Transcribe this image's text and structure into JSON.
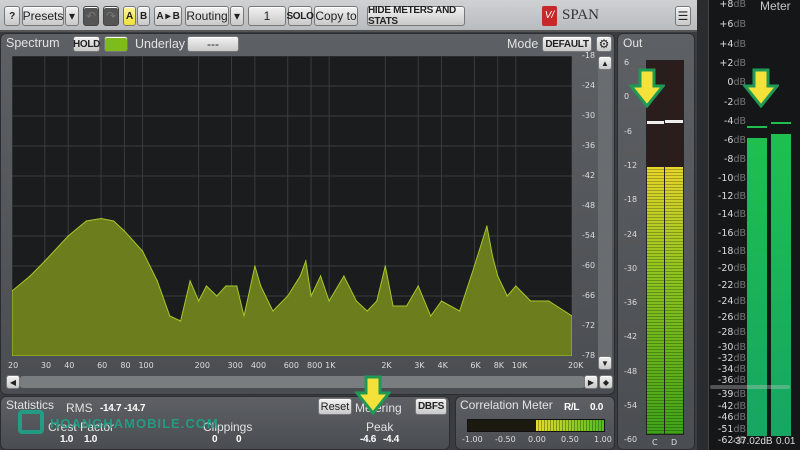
{
  "toolbar": {
    "help": "?",
    "presets": "Presets",
    "dropdown": "▾",
    "a": "A",
    "b": "B",
    "a_to_b": "A ▸ B",
    "routing": "Routing",
    "channel": "1",
    "solo": "SOLO",
    "copy_to": "Copy to",
    "hide_meters": "HIDE METERS AND STATS",
    "app_name": "SPAN",
    "menu": "☰"
  },
  "spectrum": {
    "tab": "Spectrum",
    "hold": "HOLD",
    "underlay_label": "Underlay",
    "underlay_value": "---",
    "mode_label": "Mode",
    "mode_value": "DEFAULT",
    "db_ticks": [
      "-18",
      "-24",
      "-30",
      "-36",
      "-42",
      "-48",
      "-54",
      "-60",
      "-66",
      "-72",
      "-78"
    ],
    "freq_ticks": [
      {
        "f": 20,
        "l": "20"
      },
      {
        "f": 30,
        "l": "30"
      },
      {
        "f": 40,
        "l": "40"
      },
      {
        "f": 60,
        "l": "60"
      },
      {
        "f": 80,
        "l": "80"
      },
      {
        "f": 100,
        "l": "100"
      },
      {
        "f": 200,
        "l": "200"
      },
      {
        "f": 300,
        "l": "300"
      },
      {
        "f": 400,
        "l": "400"
      },
      {
        "f": 600,
        "l": "600"
      },
      {
        "f": 800,
        "l": "800"
      },
      {
        "f": 1000,
        "l": "1K"
      },
      {
        "f": 2000,
        "l": "2K"
      },
      {
        "f": 3000,
        "l": "3K"
      },
      {
        "f": 4000,
        "l": "4K"
      },
      {
        "f": 6000,
        "l": "6K"
      },
      {
        "f": 8000,
        "l": "8K"
      },
      {
        "f": 10000,
        "l": "10K"
      },
      {
        "f": 20000,
        "l": "20K"
      }
    ]
  },
  "chart_data": {
    "type": "area",
    "xlabel": "Frequency (Hz)",
    "ylabel": "dB",
    "xscale": "log",
    "xlim": [
      20,
      20000
    ],
    "ylim": [
      -78,
      -18
    ],
    "x": [
      20,
      25,
      30,
      40,
      50,
      60,
      70,
      80,
      100,
      120,
      140,
      160,
      180,
      200,
      220,
      250,
      280,
      320,
      350,
      400,
      430,
      500,
      600,
      700,
      750,
      800,
      900,
      1000,
      1200,
      1400,
      1600,
      1800,
      2000,
      2200,
      2600,
      3000,
      3500,
      4000,
      5000,
      6000,
      7000,
      7500,
      8000,
      9000,
      10000,
      12000,
      15000,
      20000
    ],
    "y": [
      -65,
      -62,
      -59,
      -54,
      -51,
      -50.5,
      -51,
      -53,
      -57,
      -63,
      -70,
      -71,
      -63,
      -67,
      -64,
      -66,
      -64,
      -64,
      -70,
      -60,
      -64,
      -69,
      -66,
      -62,
      -59,
      -66,
      -62,
      -67,
      -62,
      -67,
      -69,
      -67,
      -60,
      -68,
      -68,
      -64,
      -70,
      -67,
      -69,
      -60,
      -52,
      -58,
      -62,
      -66,
      -64,
      -67,
      -67,
      -70
    ]
  },
  "out": {
    "tab": "Out",
    "scale": [
      "6",
      "0",
      "-6",
      "-12",
      "-18",
      "-24",
      "-30",
      "-36",
      "-42",
      "-48",
      "-54",
      "-60"
    ],
    "channels": [
      "C",
      "D"
    ],
    "level_db": -13,
    "peak_db": -4.5
  },
  "stats": {
    "tab": "Statistics",
    "rms_label": "RMS",
    "rms_l": "-14.7",
    "rms_r": "-14.7",
    "crest_label": "Crest Factor",
    "crest_l": "1.0",
    "crest_r": "1.0",
    "clip_label": "Clippings",
    "clip_l": "0",
    "clip_r": "0",
    "reset": "Reset",
    "metering_label": "Metering",
    "metering_value": "DBFS",
    "peak_label": "Peak",
    "peak_l": "-4.6",
    "peak_r": "-4.4"
  },
  "correlation": {
    "title": "Correlation Meter",
    "rl_label": "R/L",
    "rl_value": "0.0",
    "scale": [
      "-1.00",
      "-0.50",
      "0.00",
      "0.50",
      "1.00"
    ],
    "value": 0.0
  },
  "right_meter": {
    "title": "Meter",
    "scale": [
      "+8",
      "+6",
      "+4",
      "+2",
      "0",
      "-2",
      "-4",
      "-6",
      "-8",
      "-10",
      "-12",
      "-14",
      "-16",
      "-18",
      "-20",
      "-22",
      "-24",
      "-26",
      "-28",
      "-30",
      "-32",
      "-34",
      "-36",
      "-39",
      "-42",
      "-46",
      "-51",
      "-62"
    ],
    "unit": "dB",
    "readout_l": "-37.02dB",
    "readout_r": "0.01",
    "level_l_db": -5.6,
    "level_r_db": -5.3,
    "peak_l_db": -4.5,
    "peak_r_db": -4.2
  },
  "watermark": "HOANGHAMOBILE.COM",
  "colors": {
    "spectrum_fill": "#6b7d1c",
    "spectrum_line": "#a6c92a",
    "meter_green": "#1fb85a",
    "accent_yellow": "#f4e23a"
  }
}
